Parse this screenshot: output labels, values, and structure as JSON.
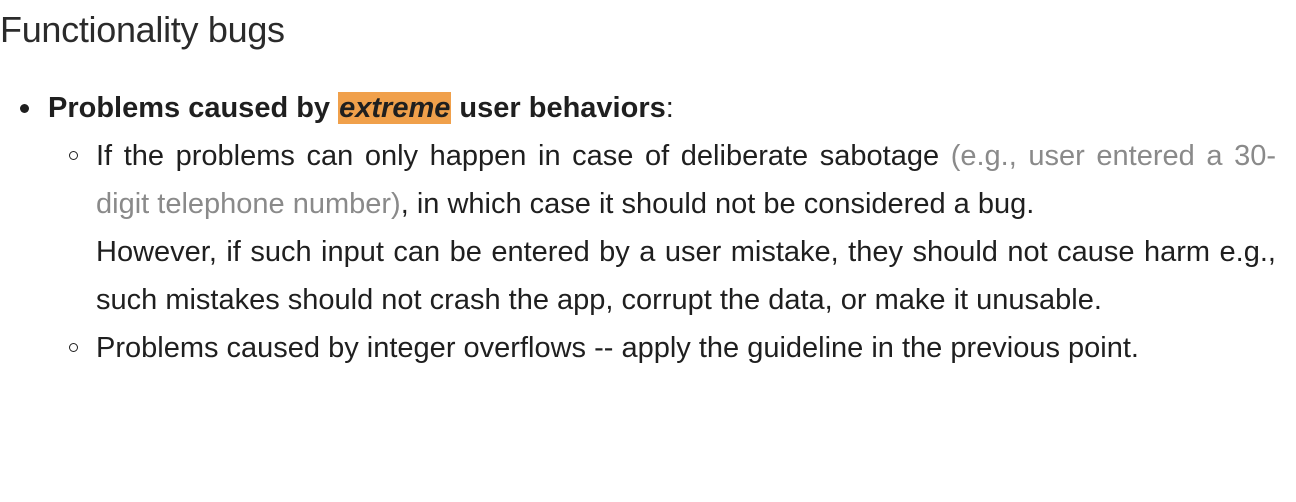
{
  "heading": "Functionality bugs",
  "bullet": {
    "prefix": "Problems caused by ",
    "highlight": "extreme",
    "suffix": " user behaviors",
    "colon": ":"
  },
  "sub_items": [
    {
      "part1": "If the problems can only happen in case of deliberate sabotage ",
      "example": "(e.g., user entered a 30-digit telephone number)",
      "part2": ", in which case it should not be considered a bug.",
      "para2": "However, if such input can be entered by a user mistake, they should not cause harm e.g., such mistakes should not crash the app, corrupt the data, or make it unusable."
    },
    {
      "text": "Problems caused by integer overflows -- apply the guideline in the previous point."
    }
  ],
  "colors": {
    "highlight": "#f0a04b",
    "muted": "#8a8a8a",
    "text": "#1f1f1f"
  }
}
